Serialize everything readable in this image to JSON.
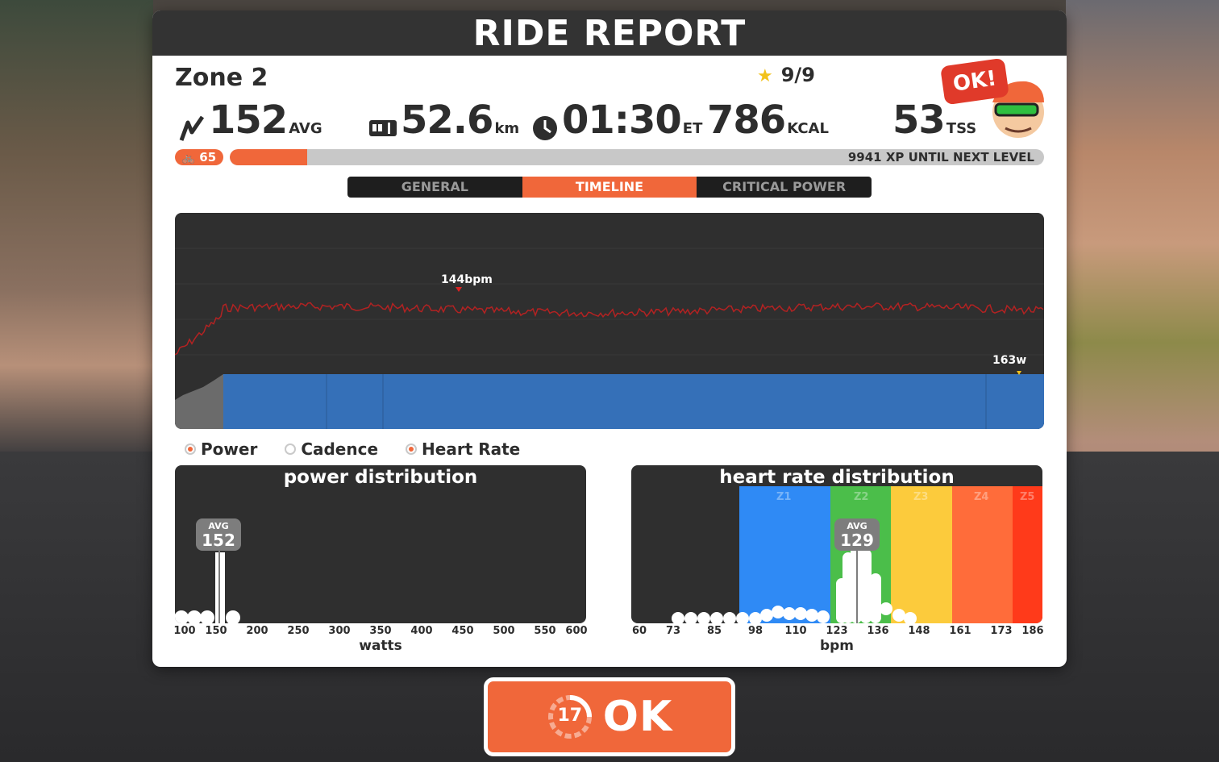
{
  "title": "RIDE REPORT",
  "route_name": "Zone 2",
  "stars": "9/9",
  "stats": {
    "power": {
      "value": "152",
      "unit": "AVG"
    },
    "distance": {
      "value": "52.6",
      "unit": "km"
    },
    "time": {
      "value": "01:30",
      "unit": "ET"
    },
    "calories": {
      "value": "786",
      "unit": "KCAL"
    },
    "tss": {
      "value": "53",
      "unit": "TSS"
    }
  },
  "ok_bubble": "OK!",
  "level": "65",
  "xp": {
    "text": "9941 XP UNTIL NEXT LEVEL",
    "progress": 0.095
  },
  "tabs": [
    {
      "label": "GENERAL",
      "active": false
    },
    {
      "label": "TIMELINE",
      "active": true
    },
    {
      "label": "CRITICAL POWER",
      "active": false
    }
  ],
  "timeline": {
    "hr_peak_label": "144bpm",
    "power_peak_label": "163w"
  },
  "legend": [
    {
      "label": "Power",
      "on": true
    },
    {
      "label": "Cadence",
      "on": false
    },
    {
      "label": "Heart Rate",
      "on": true
    }
  ],
  "power_distribution": {
    "title": "power distribution",
    "avg_label": "AVG",
    "avg_value": "152",
    "ticks": [
      "100",
      "150",
      "200",
      "250",
      "300",
      "350",
      "400",
      "450",
      "500",
      "550",
      "600"
    ],
    "axis_label": "watts"
  },
  "hr_distribution": {
    "title": "heart rate distribution",
    "avg_label": "AVG",
    "avg_value": "129",
    "ticks": [
      "60",
      "73",
      "85",
      "98",
      "110",
      "123",
      "136",
      "148",
      "161",
      "173",
      "186"
    ],
    "axis_label": "bpm",
    "zones": [
      {
        "label": "Z1",
        "color": "#2f8af5"
      },
      {
        "label": "Z2",
        "color": "#4bbe4a"
      },
      {
        "label": "Z3",
        "color": "#fccb3c"
      },
      {
        "label": "Z4",
        "color": "#ff6c3a"
      },
      {
        "label": "Z5",
        "color": "#ff3a1a"
      }
    ]
  },
  "ok_button": {
    "countdown": "17",
    "label": "OK"
  },
  "colors": {
    "accent": "#f0673a",
    "panel_dark": "#2f2f2f",
    "power_fill": "#3570b8",
    "hr_line": "#b32222"
  }
}
